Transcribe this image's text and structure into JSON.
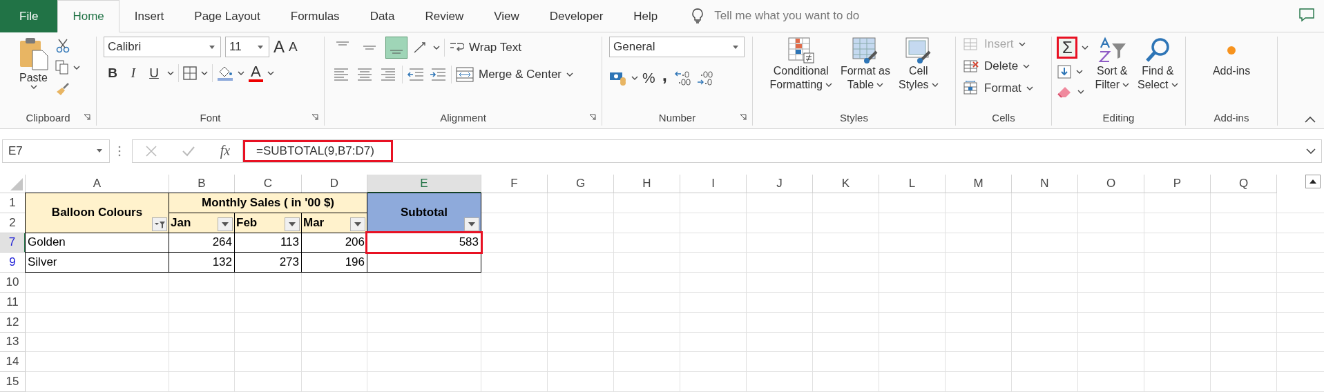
{
  "tabs": [
    {
      "label": "File",
      "kind": "file",
      "selected": false
    },
    {
      "label": "Home",
      "kind": "tab",
      "selected": true
    },
    {
      "label": "Insert",
      "kind": "tab",
      "selected": false
    },
    {
      "label": "Page Layout",
      "kind": "tab",
      "selected": false
    },
    {
      "label": "Formulas",
      "kind": "tab",
      "selected": false
    },
    {
      "label": "Data",
      "kind": "tab",
      "selected": false
    },
    {
      "label": "Review",
      "kind": "tab",
      "selected": false
    },
    {
      "label": "View",
      "kind": "tab",
      "selected": false
    },
    {
      "label": "Developer",
      "kind": "tab",
      "selected": false
    },
    {
      "label": "Help",
      "kind": "tab",
      "selected": false
    }
  ],
  "tell_me": {
    "placeholder": "Tell me what you want to do"
  },
  "ribbon": {
    "clipboard": {
      "label": "Clipboard",
      "paste": "Paste"
    },
    "font": {
      "label": "Font",
      "font_name": "Calibri",
      "font_size": "11",
      "grow": "A",
      "shrink": "A",
      "bold": "B",
      "italic": "I",
      "underline": "U",
      "font_color": "A"
    },
    "alignment": {
      "label": "Alignment",
      "wrap_text": "Wrap Text",
      "merge_center": "Merge & Center",
      "vertical_align": [
        {
          "selected": false
        },
        {
          "selected": false
        },
        {
          "selected": true
        }
      ]
    },
    "number": {
      "label": "Number",
      "format": "General",
      "percent": "%",
      "comma": ","
    },
    "styles": {
      "label": "Styles",
      "buttons": [
        {
          "kind": "conditional",
          "lines": [
            "Conditional",
            "Formatting"
          ]
        },
        {
          "kind": "table",
          "lines": [
            "Format as",
            "Table"
          ]
        },
        {
          "kind": "cellstyles",
          "lines": [
            "Cell",
            "Styles"
          ]
        }
      ]
    },
    "cells": {
      "label": "Cells",
      "buttons": [
        {
          "kind": "insert",
          "label": "Insert",
          "disabled": true
        },
        {
          "kind": "delete",
          "label": "Delete",
          "disabled": false
        },
        {
          "kind": "format",
          "label": "Format",
          "disabled": false
        }
      ]
    },
    "editing": {
      "label": "Editing",
      "autosum": "Σ",
      "autosum_highlighted": true,
      "buttons": [
        {
          "kind": "sort",
          "lines": [
            "Sort &",
            "Filter"
          ]
        },
        {
          "kind": "find",
          "lines": [
            "Find &",
            "Select"
          ]
        }
      ]
    },
    "addins": {
      "label": "Add-ins",
      "button": "Add-ins"
    }
  },
  "formula_bar": {
    "name_box": "E7",
    "fx": "fx",
    "formula": "=SUBTOTAL(9,B7:D7)",
    "highlighted": true
  },
  "sheet": {
    "columns": [
      {
        "label": "A",
        "selected": false
      },
      {
        "label": "B",
        "selected": false
      },
      {
        "label": "C",
        "selected": false
      },
      {
        "label": "D",
        "selected": false
      },
      {
        "label": "E",
        "selected": true
      },
      {
        "label": "F",
        "selected": false
      },
      {
        "label": "G",
        "selected": false
      },
      {
        "label": "H",
        "selected": false
      },
      {
        "label": "I",
        "selected": false
      },
      {
        "label": "J",
        "selected": false
      },
      {
        "label": "K",
        "selected": false
      },
      {
        "label": "L",
        "selected": false
      },
      {
        "label": "M",
        "selected": false
      },
      {
        "label": "N",
        "selected": false
      },
      {
        "label": "O",
        "selected": false
      },
      {
        "label": "P",
        "selected": false
      },
      {
        "label": "Q",
        "selected": false
      }
    ],
    "rows": [
      {
        "number": "1",
        "filtered": false,
        "selected": false
      },
      {
        "number": "2",
        "filtered": false,
        "selected": false
      },
      {
        "number": "7",
        "filtered": true,
        "selected": true
      },
      {
        "number": "9",
        "filtered": true,
        "selected": false
      },
      {
        "number": "10",
        "filtered": false,
        "selected": false
      },
      {
        "number": "11",
        "filtered": false,
        "selected": false
      },
      {
        "number": "12",
        "filtered": false,
        "selected": false
      },
      {
        "number": "13",
        "filtered": false,
        "selected": false
      },
      {
        "number": "14",
        "filtered": false,
        "selected": false
      },
      {
        "number": "15",
        "filtered": false,
        "selected": false
      }
    ],
    "table": {
      "label_header": {
        "label": "Balloon Colours",
        "filter_active": true
      },
      "group_header": "Monthly Sales ( in '00 $)",
      "months": [
        "Jan",
        "Feb",
        "Mar"
      ],
      "subtotal_header": "Subtotal",
      "rows": [
        {
          "label": "Golden",
          "values": [
            "264",
            "113",
            "206"
          ],
          "subtotal": "583",
          "highlighted": true
        },
        {
          "label": "Silver",
          "values": [
            "132",
            "273",
            "196"
          ],
          "highlighted": false
        }
      ]
    }
  }
}
